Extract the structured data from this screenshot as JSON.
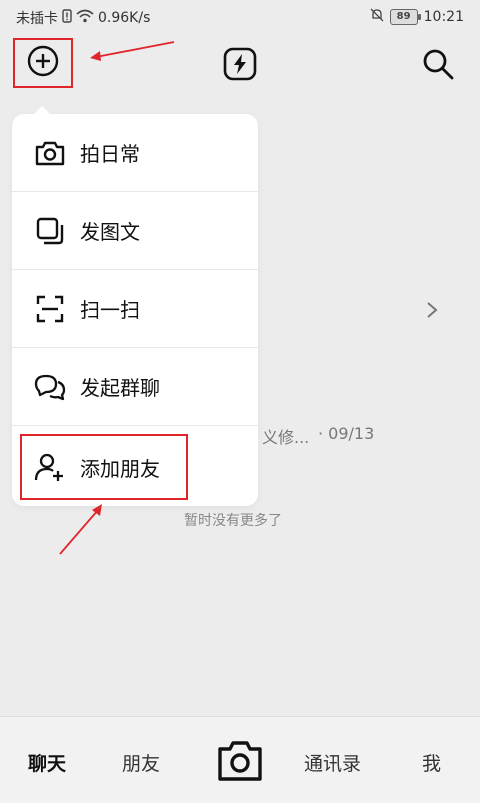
{
  "status_bar": {
    "carrier": "未插卡",
    "speed": "0.96K/s",
    "battery": "89",
    "time": "10:21"
  },
  "background": {
    "message_snippet": "义修...",
    "message_date": "· 09/13",
    "empty_note": "暂时没有更多了"
  },
  "menu": {
    "items": [
      {
        "label": "拍日常",
        "icon": "camera-icon"
      },
      {
        "label": "发图文",
        "icon": "gallery-icon"
      },
      {
        "label": "扫一扫",
        "icon": "scan-icon"
      },
      {
        "label": "发起群聊",
        "icon": "group-chat-icon"
      },
      {
        "label": "添加朋友",
        "icon": "add-friend-icon"
      }
    ]
  },
  "bottom_nav": {
    "chat": "聊天",
    "friends": "朋友",
    "contacts": "通讯录",
    "me": "我"
  },
  "colors": {
    "annotation_red": "#e0262b",
    "background": "#ececec",
    "menu_bg": "#ffffff"
  }
}
